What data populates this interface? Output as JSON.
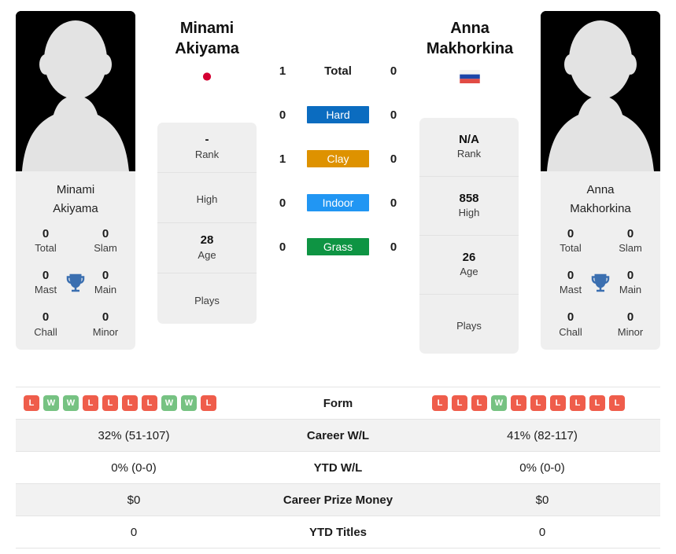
{
  "players": {
    "left": {
      "first_name": "Minami",
      "last_name": "Akiyama",
      "full_name": "Minami Akiyama",
      "caption_line1": "Minami",
      "caption_line2": "Akiyama",
      "country_flag": "japan-flag",
      "photo": "player-silhouette",
      "info": [
        {
          "value": "-",
          "label": "Rank"
        },
        {
          "value": "",
          "label": "High"
        },
        {
          "value": "28",
          "label": "Age"
        },
        {
          "value": "",
          "label": "Plays"
        }
      ],
      "titles": [
        {
          "value": "0",
          "label": "Total"
        },
        {
          "value": "0",
          "label": "Slam"
        },
        {
          "value": "0",
          "label": "Mast"
        },
        {
          "value": "0",
          "label": "Main"
        },
        {
          "value": "0",
          "label": "Chall"
        },
        {
          "value": "0",
          "label": "Minor"
        }
      ],
      "surface_counts": [
        "1",
        "0",
        "1",
        "0",
        "0"
      ],
      "form": [
        "L",
        "W",
        "W",
        "L",
        "L",
        "L",
        "L",
        "W",
        "W",
        "L"
      ],
      "career_wl": "32% (51-107)",
      "ytd_wl": "0% (0-0)",
      "career_prize_money": "$0",
      "ytd_titles": "0"
    },
    "right": {
      "first_name": "Anna",
      "last_name": "Makhorkina",
      "full_name": "Anna Makhorkina",
      "caption_line1": "Anna",
      "caption_line2": "Makhorkina",
      "country_flag": "russia-flag",
      "photo": "player-silhouette",
      "info": [
        {
          "value": "N/A",
          "label": "Rank"
        },
        {
          "value": "858",
          "label": "High"
        },
        {
          "value": "26",
          "label": "Age"
        },
        {
          "value": "",
          "label": "Plays"
        }
      ],
      "titles": [
        {
          "value": "0",
          "label": "Total"
        },
        {
          "value": "0",
          "label": "Slam"
        },
        {
          "value": "0",
          "label": "Mast"
        },
        {
          "value": "0",
          "label": "Main"
        },
        {
          "value": "0",
          "label": "Chall"
        },
        {
          "value": "0",
          "label": "Minor"
        }
      ],
      "surface_counts": [
        "0",
        "0",
        "0",
        "0",
        "0"
      ],
      "form": [
        "L",
        "L",
        "L",
        "W",
        "L",
        "L",
        "L",
        "L",
        "L",
        "L"
      ],
      "career_wl": "41% (82-117)",
      "ytd_wl": "0% (0-0)",
      "career_prize_money": "$0",
      "ytd_titles": "0"
    }
  },
  "surfaces": [
    {
      "label": "Total",
      "color": "transparent",
      "plain": true
    },
    {
      "label": "Hard",
      "color": "#0b6cc0",
      "plain": false
    },
    {
      "label": "Clay",
      "color": "#de9200",
      "plain": false
    },
    {
      "label": "Indoor",
      "color": "#2196f3",
      "plain": false
    },
    {
      "label": "Grass",
      "color": "#0e9443",
      "plain": false
    }
  ],
  "table": {
    "rows": [
      {
        "key": "form",
        "label": "Form"
      },
      {
        "key": "career_wl",
        "label": "Career W/L"
      },
      {
        "key": "ytd_wl",
        "label": "YTD W/L"
      },
      {
        "key": "prize",
        "label": "Career Prize Money"
      },
      {
        "key": "titles",
        "label": "YTD Titles"
      }
    ]
  },
  "colors": {
    "hard": "#0b6cc0",
    "clay": "#de9200",
    "indoor": "#2196f3",
    "grass": "#0e9443",
    "win": "#76c282",
    "loss": "#ef5d4b",
    "trophy": "#3b6fb0",
    "card_bg": "#efefef",
    "row_shade": "#f2f2f2"
  }
}
